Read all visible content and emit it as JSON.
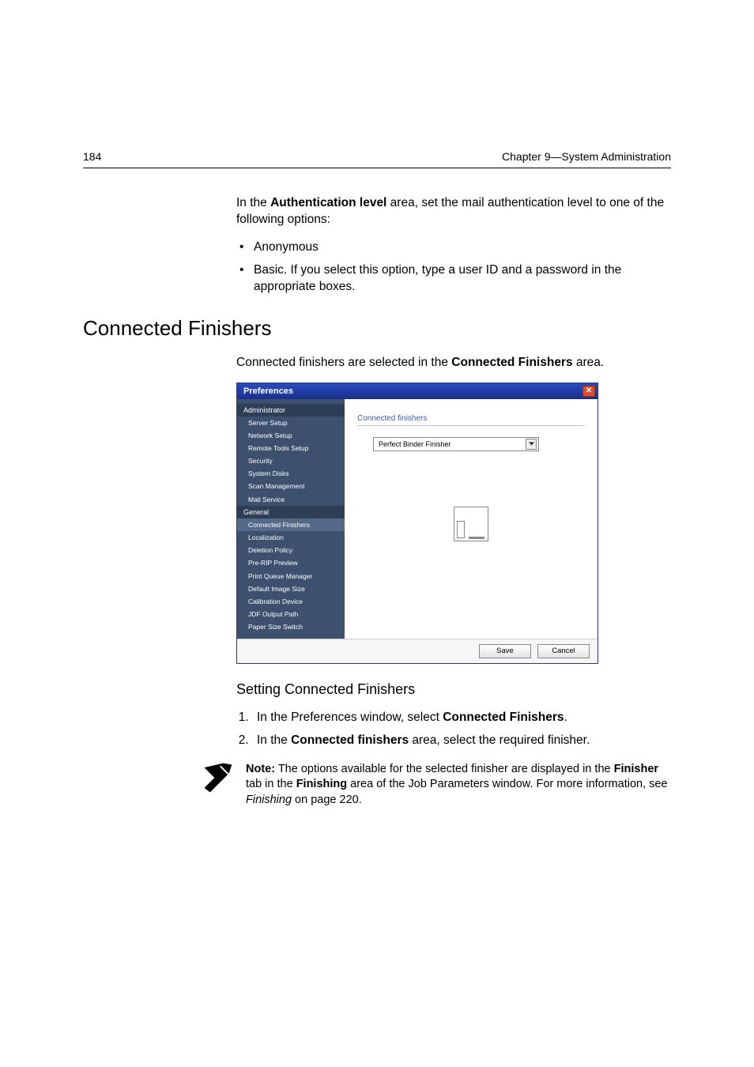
{
  "header": {
    "page_number": "184",
    "chapter": "Chapter 9—System Administration"
  },
  "intro": {
    "line_prefix": "In the ",
    "bold1": "Authentication level",
    "line_suffix": " area, set the mail authentication level to one of the following options:",
    "bullets": {
      "b1": "Anonymous",
      "b2": "Basic. If you select this option, type a user ID and a password in the appropriate boxes."
    }
  },
  "section_title": "Connected Finishers",
  "section_intro_prefix": "Connected finishers are selected in the ",
  "section_intro_bold": "Connected Finishers",
  "section_intro_suffix": " area.",
  "dialog": {
    "title": "Preferences",
    "groups": {
      "g1": "Administrator",
      "g2": "General"
    },
    "items": {
      "i1": "Server Setup",
      "i2": "Network Setup",
      "i3": "Remote Tools Setup",
      "i4": "Security",
      "i5": "System Disks",
      "i6": "Scan Management",
      "i7": "Mail Service",
      "i8": "Connected Finishers",
      "i9": "Localization",
      "i10": "Deletion Policy",
      "i11": "Pre-RIP Preview",
      "i12": "Print Queue Manager",
      "i13": "Default Image Size",
      "i14": "Calibration Device",
      "i15": "JDF Output Path",
      "i16": "Paper Size Switch"
    },
    "content_header": "Connected finishers",
    "combo_value": "Perfect Binder Finisher",
    "save": "Save",
    "cancel": "Cancel"
  },
  "subsection_title": "Setting Connected Finishers",
  "steps": {
    "s1_prefix": "In the Preferences window, select ",
    "s1_bold": "Connected Finishers",
    "s1_suffix": ".",
    "s2_prefix": "In the ",
    "s2_bold": "Connected finishers",
    "s2_suffix": " area, select the required finisher."
  },
  "note": {
    "label": "Note:",
    "t1": "  The options available for the selected finisher are displayed in the ",
    "b1": "Finisher",
    "t2": " tab in the ",
    "b2": "Finishing",
    "t3": " area of the Job Parameters window. For more information, see ",
    "i1": "Finishing",
    "t4": " on page 220."
  }
}
